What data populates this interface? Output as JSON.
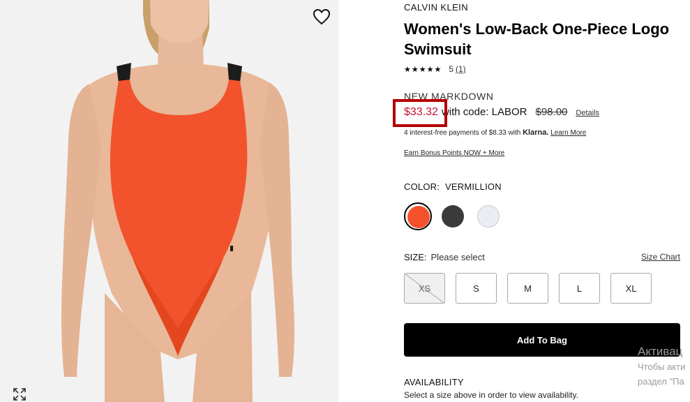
{
  "product": {
    "brand": "CALVIN KLEIN",
    "title": "Women's Low-Back One-Piece Logo Swimsuit",
    "rating": {
      "stars": "★★★★★",
      "value": "5",
      "count": "(1)"
    },
    "markdown_label": "NEW MARKDOWN",
    "sale_price": "$33.32",
    "price_code_text": "with code: LABOR",
    "original_price": "$98.00",
    "details_link": "Details",
    "klarna": {
      "prefix": "4 interest-free payments of $8.33 with",
      "brand": "Klarna.",
      "learn_more": "Learn More"
    },
    "bonus_link": "Earn Bonus Points NOW + More"
  },
  "color": {
    "label": "COLOR:",
    "selected": "VERMILLION",
    "swatches": [
      {
        "name": "vermillion",
        "hex": "#f5512c",
        "selected": true
      },
      {
        "name": "black",
        "hex": "#3a3a3a",
        "selected": false
      },
      {
        "name": "white",
        "hex": "#ecedf3",
        "selected": false
      }
    ]
  },
  "size": {
    "label": "SIZE:",
    "prompt": "Please select",
    "chart_link": "Size Chart",
    "options": [
      {
        "label": "XS",
        "available": false
      },
      {
        "label": "S",
        "available": true
      },
      {
        "label": "M",
        "available": true
      },
      {
        "label": "L",
        "available": true
      },
      {
        "label": "XL",
        "available": true
      }
    ]
  },
  "actions": {
    "add_to_bag": "Add To Bag"
  },
  "availability": {
    "title": "AVAILABILITY",
    "text": "Select a size above in order to view availability."
  },
  "watermark": {
    "title": "Активац",
    "line1": "Чтобы акти",
    "line2": "раздел \"Па"
  },
  "colors": {
    "sale_red": "#c8102e",
    "highlight_box": "#b40000",
    "swimsuit": "#f2532d"
  },
  "icons": [
    "heart-icon",
    "expand-icon"
  ]
}
